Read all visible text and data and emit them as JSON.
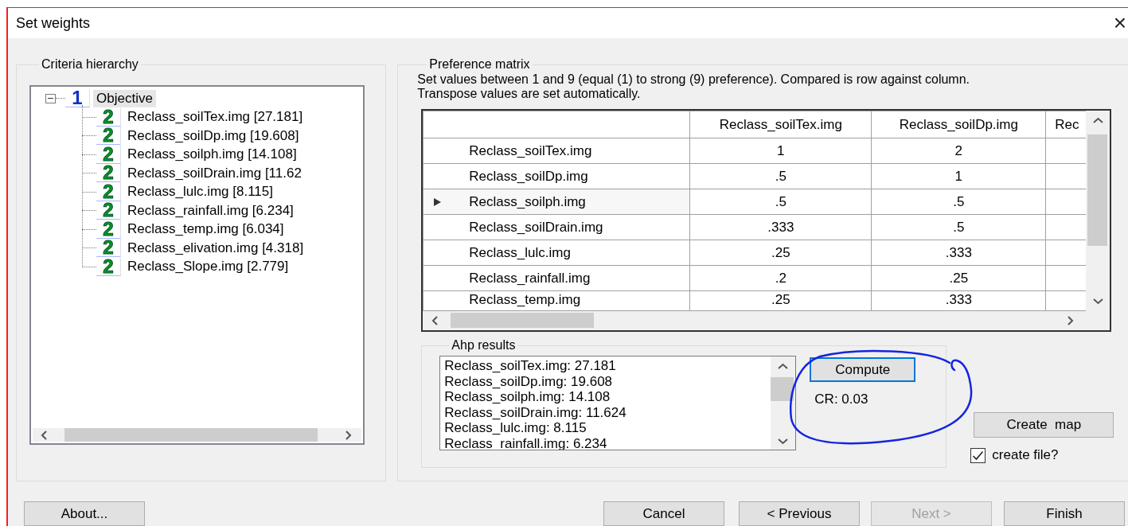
{
  "window": {
    "title": "Set weights",
    "close": "×"
  },
  "criteria_hierarchy": {
    "title": "Criteria hierarchy",
    "tree": {
      "badge": "1",
      "label": "Objective",
      "expanded": true,
      "selected": true,
      "children": [
        {
          "badge": "2",
          "label": "Reclass_soilTex.img [27.181]",
          "selected": false
        },
        {
          "badge": "2",
          "label": "Reclass_soilDp.img [19.608]",
          "selected": false
        },
        {
          "badge": "2",
          "label": "Reclass_soilph.img [14.108]",
          "selected": false
        },
        {
          "badge": "2",
          "label": "Reclass_soilDrain.img [11.62",
          "selected": false
        },
        {
          "badge": "2",
          "label": "Reclass_lulc.img [8.115]",
          "selected": false
        },
        {
          "badge": "2",
          "label": "Reclass_rainfall.img [6.234]",
          "selected": false
        },
        {
          "badge": "2",
          "label": "Reclass_temp.img [6.034]",
          "selected": false
        },
        {
          "badge": "2",
          "label": "Reclass_elivation.img [4.318]",
          "selected": false
        },
        {
          "badge": "2",
          "label": "Reclass_Slope.img [2.779]",
          "selected": false
        }
      ]
    }
  },
  "preference_matrix": {
    "title": "Preference matrix",
    "description": "Set values between 1 and 9 (equal (1) to strong (9) preference). Compared is row against column. Transpose values are set automatically.",
    "columns": [
      "Reclass_soilTex.img",
      "Reclass_soilDp.img",
      "Rec"
    ],
    "rows": [
      {
        "header": "Reclass_soilTex.img",
        "cells": [
          "1",
          "2"
        ],
        "selected": false
      },
      {
        "header": "Reclass_soilDp.img",
        "cells": [
          ".5",
          "1"
        ],
        "selected": false
      },
      {
        "header": "Reclass_soilph.img",
        "cells": [
          ".5",
          ".5"
        ],
        "selected": true
      },
      {
        "header": "Reclass_soilDrain.img",
        "cells": [
          ".333",
          ".5"
        ],
        "selected": false
      },
      {
        "header": "Reclass_lulc.img",
        "cells": [
          ".25",
          ".333"
        ],
        "selected": false
      },
      {
        "header": "Reclass_rainfall.img",
        "cells": [
          ".2",
          ".25"
        ],
        "selected": false
      },
      {
        "header": "Reclass_temp.img",
        "cells": [
          ".25",
          ".333"
        ],
        "selected": false
      }
    ]
  },
  "ahp_results": {
    "title": "Ahp results",
    "items": [
      "Reclass_soilTex.img: 27.181",
      "Reclass_soilDp.img: 19.608",
      "Reclass_soilph.img: 14.108",
      "Reclass_soilDrain.img: 11.624",
      "Reclass_lulc.img: 8.115",
      "Reclass_rainfall.img: 6.234"
    ],
    "compute": {
      "label": "Compute",
      "focused": true
    },
    "cr": "CR: 0.03"
  },
  "create_map": {
    "label": "Create  map"
  },
  "create_file": {
    "label": "create file?",
    "checked": true
  },
  "annotation": {
    "kind": "freehand-circle"
  },
  "buttons": [
    {
      "label": "About...",
      "disabled": false
    },
    {
      "label": "Cancel",
      "disabled": false
    },
    {
      "label": "< Previous",
      "disabled": false
    },
    {
      "label": "Next >",
      "disabled": true
    },
    {
      "label": "Finish",
      "disabled": false
    }
  ]
}
